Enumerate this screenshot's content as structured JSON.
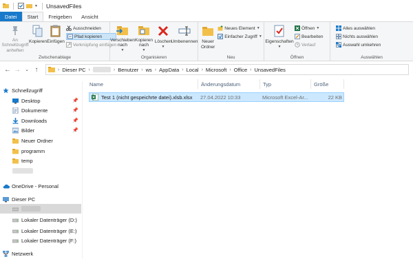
{
  "window": {
    "title": "UnsavedFiles"
  },
  "tabs": [
    {
      "label": "Datei"
    },
    {
      "label": "Start"
    },
    {
      "label": "Freigeben"
    },
    {
      "label": "Ansicht"
    }
  ],
  "ribbon": {
    "clipboard": {
      "label": "Zwischenablage",
      "pin": "An Schnellzugriff anheften",
      "copy": "Kopieren",
      "paste": "Einfügen",
      "cut": "Ausschneiden",
      "copy_path": "Pfad kopieren",
      "paste_shortcut": "Verknüpfung einfügen"
    },
    "organize": {
      "label": "Organisieren",
      "move_to": "Verschieben nach",
      "copy_to": "Kopieren nach",
      "delete": "Löschen",
      "rename": "Umbenennen"
    },
    "new": {
      "label": "Neu",
      "new_folder": "Neuer Ordner",
      "new_item": "Neues Element",
      "easy_access": "Einfacher Zugriff"
    },
    "open": {
      "label": "Öffnen",
      "properties": "Eigenschaften",
      "open": "Öffnen",
      "edit": "Bearbeiten",
      "history": "Verlauf"
    },
    "select": {
      "label": "Auswählen",
      "select_all": "Alles auswählen",
      "select_none": "Nichts auswählen",
      "invert": "Auswahl umkehren"
    }
  },
  "address": {
    "segments": [
      "Dieser PC",
      "Benutzer",
      "ws",
      "AppData",
      "Local",
      "Microsoft",
      "Office",
      "UnsavedFiles"
    ]
  },
  "nav": {
    "quick_access": "Schnellzugriff",
    "desktop": "Desktop",
    "documents": "Dokumente",
    "downloads": "Downloads",
    "pictures": "Bilder",
    "new_folder": "Neuer Ordner",
    "programm": "programm",
    "temp": "temp",
    "onedrive": "OneDrive - Personal",
    "this_pc": "Dieser PC",
    "drive_d": "Lokaler Datenträger (D:)",
    "drive_e": "Lokaler Datenträger (E:)",
    "drive_f": "Lokaler Datenträger (F:)",
    "network": "Netzwerk"
  },
  "columns": {
    "name": "Name",
    "modified": "Änderungsdatum",
    "type": "Typ",
    "size": "Größe"
  },
  "files": [
    {
      "name": "Test 1 (nicht gespeichrte datei).xlsb.xlsx",
      "modified": "27.04.2022 10:33",
      "type": "Microsoft Excel-Ar...",
      "size": "22 KB"
    }
  ],
  "colors": {
    "file_tab": "#1979ca",
    "selection": "#cce8ff",
    "folder": "#f2c04a",
    "excel": "#1e7145"
  }
}
